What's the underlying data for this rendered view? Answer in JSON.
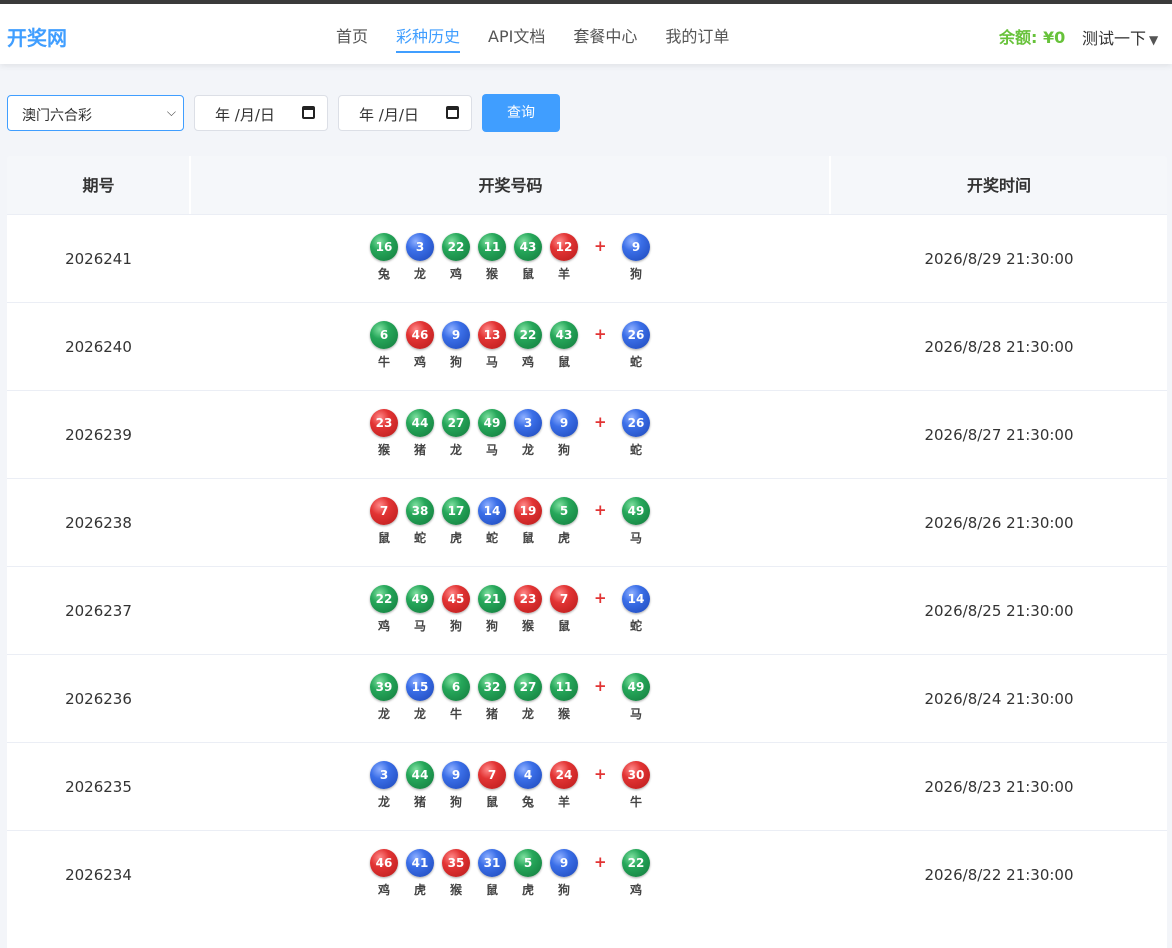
{
  "header": {
    "logo": "开奖网",
    "nav": [
      {
        "label": "首页",
        "active": false
      },
      {
        "label": "彩种历史",
        "active": true
      },
      {
        "label": "API文档",
        "active": false
      },
      {
        "label": "套餐中心",
        "active": false
      },
      {
        "label": "我的订单",
        "active": false
      }
    ],
    "balance": "余额: ¥0",
    "user": "测试一下"
  },
  "filter": {
    "lottery": "澳门六合彩",
    "date_start": "年 /月/日",
    "date_end": "年 /月/日",
    "query_label": "查询"
  },
  "table": {
    "columns": [
      "期号",
      "开奖号码",
      "开奖时间"
    ],
    "plus": "+",
    "rows": [
      {
        "issue": "2026241",
        "time": "2026/8/29 21:30:00",
        "balls": [
          {
            "n": "16",
            "c": "green",
            "z": "兔"
          },
          {
            "n": "3",
            "c": "blue",
            "z": "龙"
          },
          {
            "n": "22",
            "c": "green",
            "z": "鸡"
          },
          {
            "n": "11",
            "c": "green",
            "z": "猴"
          },
          {
            "n": "43",
            "c": "green",
            "z": "鼠"
          },
          {
            "n": "12",
            "c": "red",
            "z": "羊"
          }
        ],
        "special": {
          "n": "9",
          "c": "blue",
          "z": "狗"
        }
      },
      {
        "issue": "2026240",
        "time": "2026/8/28 21:30:00",
        "balls": [
          {
            "n": "6",
            "c": "green",
            "z": "牛"
          },
          {
            "n": "46",
            "c": "red",
            "z": "鸡"
          },
          {
            "n": "9",
            "c": "blue",
            "z": "狗"
          },
          {
            "n": "13",
            "c": "red",
            "z": "马"
          },
          {
            "n": "22",
            "c": "green",
            "z": "鸡"
          },
          {
            "n": "43",
            "c": "green",
            "z": "鼠"
          }
        ],
        "special": {
          "n": "26",
          "c": "blue",
          "z": "蛇"
        }
      },
      {
        "issue": "2026239",
        "time": "2026/8/27 21:30:00",
        "balls": [
          {
            "n": "23",
            "c": "red",
            "z": "猴"
          },
          {
            "n": "44",
            "c": "green",
            "z": "猪"
          },
          {
            "n": "27",
            "c": "green",
            "z": "龙"
          },
          {
            "n": "49",
            "c": "green",
            "z": "马"
          },
          {
            "n": "3",
            "c": "blue",
            "z": "龙"
          },
          {
            "n": "9",
            "c": "blue",
            "z": "狗"
          }
        ],
        "special": {
          "n": "26",
          "c": "blue",
          "z": "蛇"
        }
      },
      {
        "issue": "2026238",
        "time": "2026/8/26 21:30:00",
        "balls": [
          {
            "n": "7",
            "c": "red",
            "z": "鼠"
          },
          {
            "n": "38",
            "c": "green",
            "z": "蛇"
          },
          {
            "n": "17",
            "c": "green",
            "z": "虎"
          },
          {
            "n": "14",
            "c": "blue",
            "z": "蛇"
          },
          {
            "n": "19",
            "c": "red",
            "z": "鼠"
          },
          {
            "n": "5",
            "c": "green",
            "z": "虎"
          }
        ],
        "special": {
          "n": "49",
          "c": "green",
          "z": "马"
        }
      },
      {
        "issue": "2026237",
        "time": "2026/8/25 21:30:00",
        "balls": [
          {
            "n": "22",
            "c": "green",
            "z": "鸡"
          },
          {
            "n": "49",
            "c": "green",
            "z": "马"
          },
          {
            "n": "45",
            "c": "red",
            "z": "狗"
          },
          {
            "n": "21",
            "c": "green",
            "z": "狗"
          },
          {
            "n": "23",
            "c": "red",
            "z": "猴"
          },
          {
            "n": "7",
            "c": "red",
            "z": "鼠"
          }
        ],
        "special": {
          "n": "14",
          "c": "blue",
          "z": "蛇"
        }
      },
      {
        "issue": "2026236",
        "time": "2026/8/24 21:30:00",
        "balls": [
          {
            "n": "39",
            "c": "green",
            "z": "龙"
          },
          {
            "n": "15",
            "c": "blue",
            "z": "龙"
          },
          {
            "n": "6",
            "c": "green",
            "z": "牛"
          },
          {
            "n": "32",
            "c": "green",
            "z": "猪"
          },
          {
            "n": "27",
            "c": "green",
            "z": "龙"
          },
          {
            "n": "11",
            "c": "green",
            "z": "猴"
          }
        ],
        "special": {
          "n": "49",
          "c": "green",
          "z": "马"
        }
      },
      {
        "issue": "2026235",
        "time": "2026/8/23 21:30:00",
        "balls": [
          {
            "n": "3",
            "c": "blue",
            "z": "龙"
          },
          {
            "n": "44",
            "c": "green",
            "z": "猪"
          },
          {
            "n": "9",
            "c": "blue",
            "z": "狗"
          },
          {
            "n": "7",
            "c": "red",
            "z": "鼠"
          },
          {
            "n": "4",
            "c": "blue",
            "z": "兔"
          },
          {
            "n": "24",
            "c": "red",
            "z": "羊"
          }
        ],
        "special": {
          "n": "30",
          "c": "red",
          "z": "牛"
        }
      },
      {
        "issue": "2026234",
        "time": "2026/8/22 21:30:00",
        "balls": [
          {
            "n": "46",
            "c": "red",
            "z": "鸡"
          },
          {
            "n": "41",
            "c": "blue",
            "z": "虎"
          },
          {
            "n": "35",
            "c": "red",
            "z": "猴"
          },
          {
            "n": "31",
            "c": "blue",
            "z": "鼠"
          },
          {
            "n": "5",
            "c": "green",
            "z": "虎"
          },
          {
            "n": "9",
            "c": "blue",
            "z": "狗"
          }
        ],
        "special": {
          "n": "22",
          "c": "green",
          "z": "鸡"
        }
      }
    ]
  }
}
